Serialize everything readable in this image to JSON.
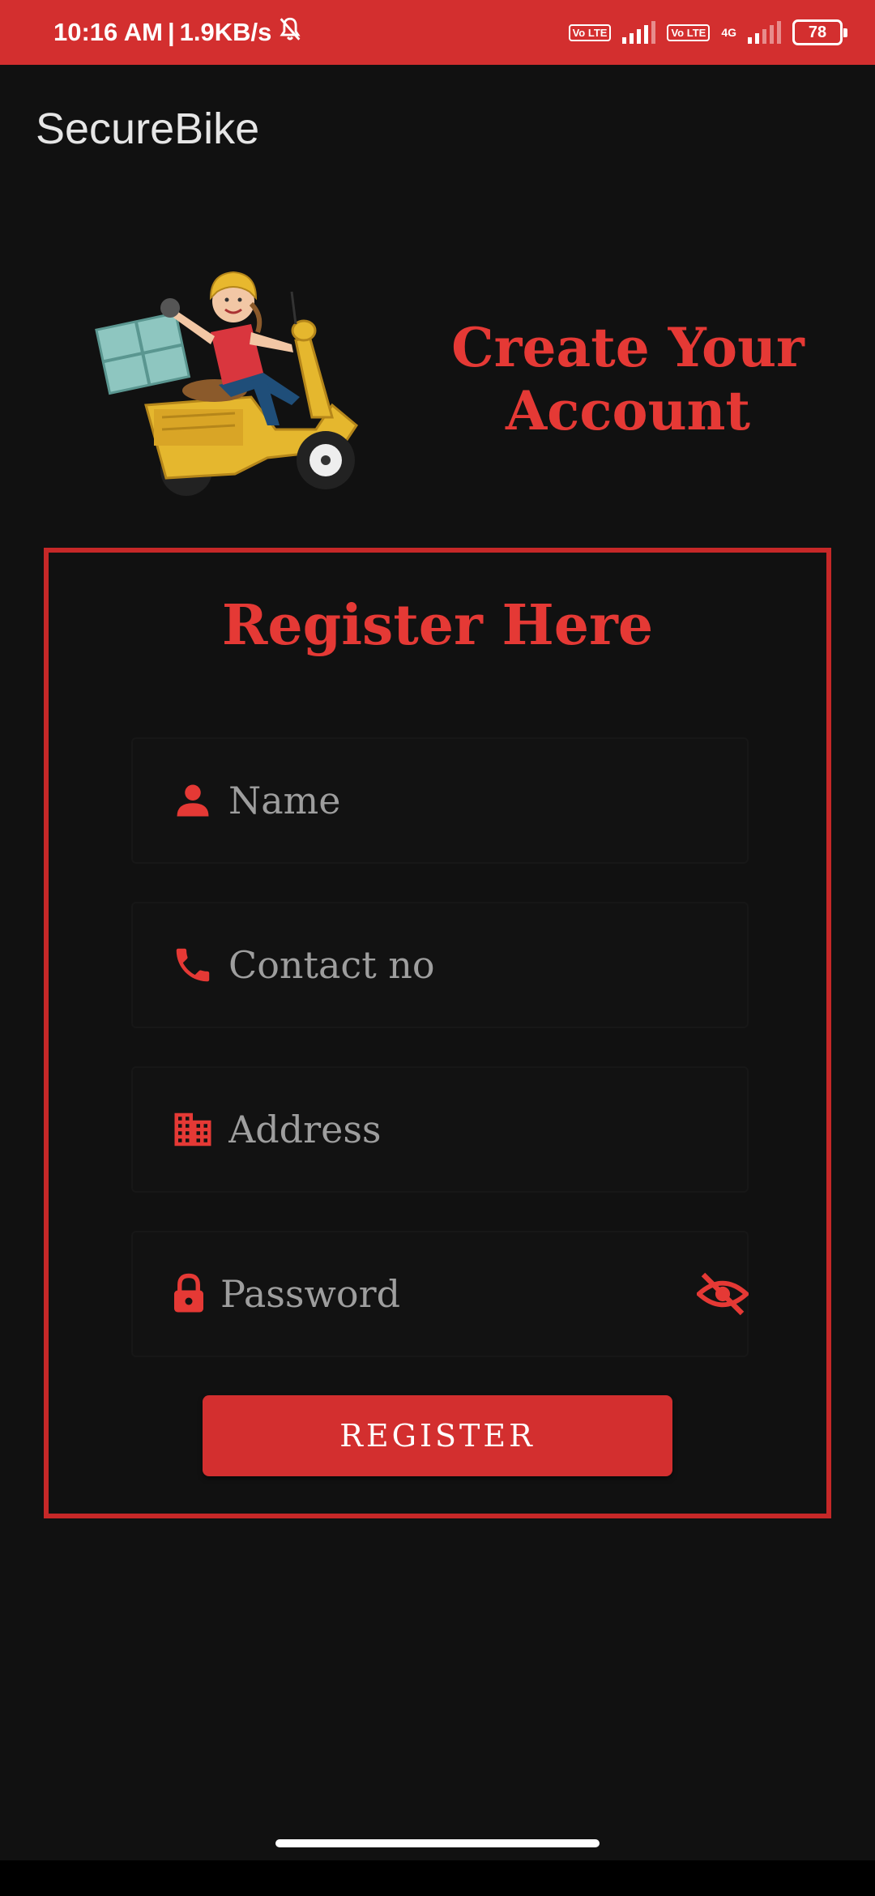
{
  "status_bar": {
    "time": "10:16 AM",
    "separator": "|",
    "net_speed": "1.9KB/s",
    "volte_label_1": "Vo LTE",
    "volte_label_2": "Vo LTE",
    "network_type": "4G",
    "battery_level": "78"
  },
  "app_bar": {
    "title": "SecureBike"
  },
  "hero": {
    "title_line1": "Create Your",
    "title_line2": "Account"
  },
  "form": {
    "heading": "Register Here",
    "name_placeholder": "Name",
    "contact_placeholder": "Contact no",
    "address_placeholder": "Address",
    "password_placeholder": "Password",
    "register_label": "REGISTER"
  },
  "icons": {
    "name": "person-icon",
    "contact": "phone-icon",
    "address": "building-icon",
    "password": "lock-icon",
    "toggle": "eye-off-icon"
  },
  "colors": {
    "accent": "#d32f2f",
    "accent_text": "#e53935",
    "background": "#111111"
  }
}
